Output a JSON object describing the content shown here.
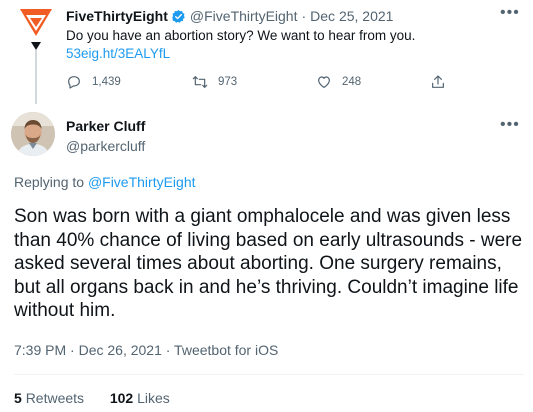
{
  "parent": {
    "name": "FiveThirtyEight",
    "handle": "@FiveThirtyEight",
    "separator": "·",
    "date": "Dec 25, 2021",
    "text": "Do you have an abortion story? We want to hear from you.",
    "link": "53eig.ht/3EALYfL",
    "brand_color": "#f05c23",
    "actions": {
      "replies": "1,439",
      "retweets": "973",
      "likes": "248"
    }
  },
  "reply": {
    "name": "Parker Cluff",
    "handle": "@parkercluff",
    "replying_prefix": "Replying to",
    "replying_to": "@FiveThirtyEight",
    "text": "Son was born with a giant omphalocele and was given less than 40% chance of living based on early ultrasounds - were asked several times about aborting. One surgery remains, but all organs back in and he’s thriving. Couldn’t imagine life without him.",
    "timestamp": "7:39 PM · Dec 26, 2021 · Tweetbot for iOS",
    "retweets_count": "5",
    "retweets_label": "Retweets",
    "likes_count": "102",
    "likes_label": "Likes"
  },
  "icons": {
    "more": "•••",
    "verified": "verified-badge-icon",
    "reply": "reply-icon",
    "retweet": "retweet-icon",
    "like": "heart-icon",
    "share": "share-icon"
  },
  "colors": {
    "link": "#1d9bf0",
    "muted": "#536471",
    "text": "#0f1419"
  }
}
